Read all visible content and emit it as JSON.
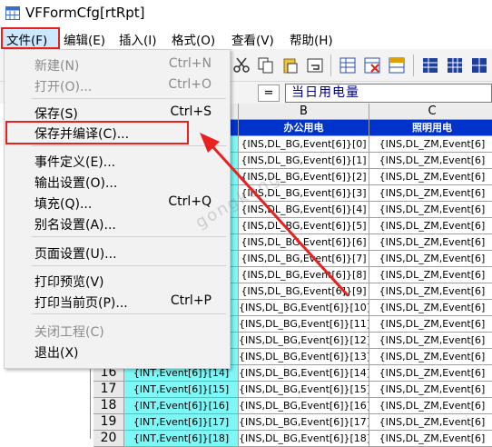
{
  "window": {
    "title": "VFFormCfg[rtRpt]"
  },
  "menubar": {
    "items": [
      {
        "label": "文件(F)"
      },
      {
        "label": "编辑(E)"
      },
      {
        "label": "插入(I)"
      },
      {
        "label": "格式(O)"
      },
      {
        "label": "查看(V)"
      },
      {
        "label": "帮助(H)"
      }
    ]
  },
  "formula": {
    "equals": "=",
    "content": "当日用电量"
  },
  "file_menu": {
    "items": [
      {
        "label": "新建(N)",
        "shortcut": "Ctrl+N",
        "disabled": true
      },
      {
        "label": "打开(O)...",
        "shortcut": "Ctrl+O",
        "disabled": true
      },
      {
        "label": "保存(S)",
        "shortcut": "Ctrl+S",
        "disabled": false
      },
      {
        "label": "保存并编译(C)...",
        "shortcut": "",
        "disabled": false
      },
      {
        "label": "事件定义(E)...",
        "shortcut": "",
        "disabled": false
      },
      {
        "label": "输出设置(O)...",
        "shortcut": "",
        "disabled": false
      },
      {
        "label": "填充(Q)...",
        "shortcut": "Ctrl+Q",
        "disabled": false
      },
      {
        "label": "别名设置(A)...",
        "shortcut": "",
        "disabled": false
      },
      {
        "label": "页面设置(U)...",
        "shortcut": "",
        "disabled": false
      },
      {
        "label": "打印预览(V)",
        "shortcut": "",
        "disabled": false
      },
      {
        "label": "打印当前页(P)...",
        "shortcut": "Ctrl+P",
        "disabled": false
      },
      {
        "label": "关闭工程(C)",
        "shortcut": "",
        "disabled": true
      },
      {
        "label": "退出(X)",
        "shortcut": "",
        "disabled": false
      }
    ]
  },
  "sheet": {
    "columns": [
      "B",
      "C"
    ],
    "header_row": [
      "办公用电",
      "照明用电"
    ],
    "rows": [
      {
        "n": "",
        "a": "",
        "b": "{INS,DL_BG,Event[6]}[0]",
        "c": "{INS,DL_ZM,Event[6]"
      },
      {
        "n": "",
        "a": "",
        "b": "{INS,DL_BG,Event[6]}[1]",
        "c": "{INS,DL_ZM,Event[6]"
      },
      {
        "n": "",
        "a": "",
        "b": "{INS,DL_BG,Event[6]}[2]",
        "c": "{INS,DL_ZM,Event[6]"
      },
      {
        "n": "",
        "a": "",
        "b": "{INS,DL_BG,Event[6]}[3]",
        "c": "{INS,DL_ZM,Event[6]"
      },
      {
        "n": "",
        "a": "",
        "b": "{INS,DL_BG,Event[6]}[4]",
        "c": "{INS,DL_ZM,Event[6]"
      },
      {
        "n": "",
        "a": "",
        "b": "{INS,DL_BG,Event[6]}[5]",
        "c": "{INS,DL_ZM,Event[6]"
      },
      {
        "n": "",
        "a": "",
        "b": "{INS,DL_BG,Event[6]}[6]",
        "c": "{INS,DL_ZM,Event[6]"
      },
      {
        "n": "",
        "a": "",
        "b": "{INS,DL_BG,Event[6]}[7]",
        "c": "{INS,DL_ZM,Event[6]"
      },
      {
        "n": "",
        "a": "",
        "b": "{INS,DL_BG,Event[6]}[8]",
        "c": "{INS,DL_ZM,Event[6]"
      },
      {
        "n": "",
        "a": "",
        "b": "{INS,DL_BG,Event[6]}[9]",
        "c": "{INS,DL_ZM,Event[6]"
      },
      {
        "n": "",
        "a": "",
        "b": "{INS,DL_BG,Event[6]}[10]",
        "c": "{INS,DL_ZM,Event[6]"
      },
      {
        "n": "",
        "a": "",
        "b": "{INS,DL_BG,Event[6]}[11]",
        "c": "{INS,DL_ZM,Event[6]"
      },
      {
        "n": "",
        "a": "",
        "b": "{INS,DL_BG,Event[6]}[12]",
        "c": "{INS,DL_ZM,Event[6]"
      },
      {
        "n": "",
        "a": "",
        "b": "{INS,DL_BG,Event[6]}[13]",
        "c": "{INS,DL_ZM,Event[6]"
      },
      {
        "n": "16",
        "a": "{INT,Event[6]}[14]",
        "b": "{INS,DL_BG,Event[6]}[14]",
        "c": "{INS,DL_ZM,Event[6]"
      },
      {
        "n": "17",
        "a": "{INT,Event[6]}[15]",
        "b": "{INS,DL_BG,Event[6]}[15]",
        "c": "{INS,DL_ZM,Event[6]"
      },
      {
        "n": "18",
        "a": "{INT,Event[6]}[16]",
        "b": "{INS,DL_BG,Event[6]}[16]",
        "c": "{INS,DL_ZM,Event[6]"
      },
      {
        "n": "19",
        "a": "{INT,Event[6]}[17]",
        "b": "{INS,DL_BG,Event[6]}[17]",
        "c": "{INS,DL_ZM,Event[6]"
      },
      {
        "n": "20",
        "a": "{INT,Event[6]}[18]",
        "b": "{INS,DL_BG,Event[6]}[18]",
        "c": "{INS,DL_ZM,Event[6]"
      }
    ]
  },
  "watermark": "gongkong",
  "colors": {
    "highlight_red": "#e8211f",
    "header_blue": "#0033cc",
    "cyan_col": "#7ef7f7"
  }
}
